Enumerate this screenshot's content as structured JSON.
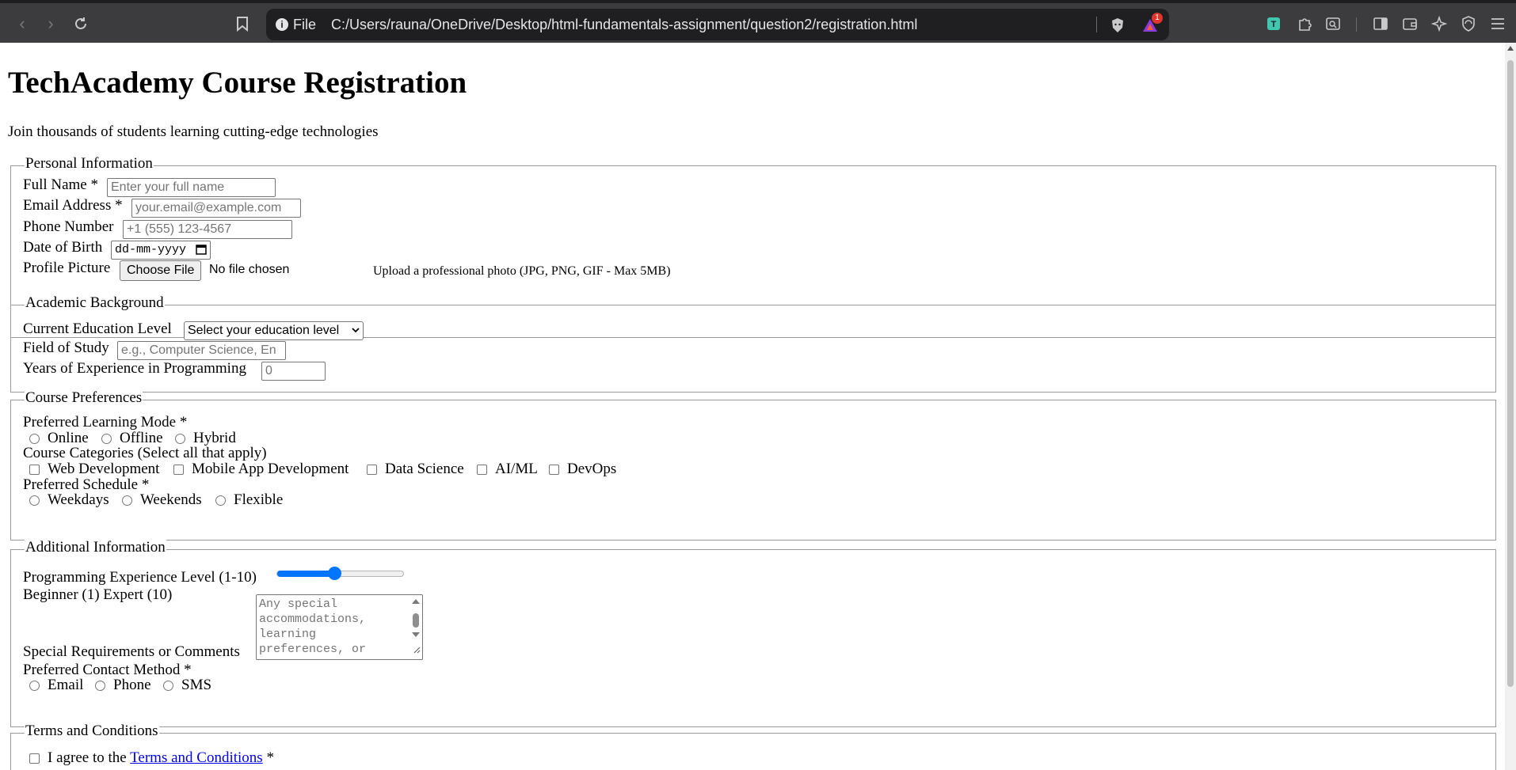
{
  "browser": {
    "file_label": "File",
    "url": "C:/Users/rauna/OneDrive/Desktop/html-fundamentals-assignment/question2/registration.html",
    "notification_count": "1"
  },
  "page": {
    "title": "TechAcademy Course Registration",
    "subtitle": "Join thousands of students learning cutting-edge technologies"
  },
  "personal": {
    "legend": "Personal Information",
    "full_name_label": "Full Name *",
    "full_name_placeholder": "Enter your full name",
    "email_label": "Email Address *",
    "email_placeholder": "your.email@example.com",
    "phone_label": "Phone Number",
    "phone_placeholder": "+1 (555) 123-4567",
    "dob_label": "Date of Birth",
    "dob_value": "dd-mm-yyyy",
    "picture_label": "Profile Picture",
    "choose_file": "Choose File",
    "no_file": "No file chosen",
    "picture_hint": "Upload a professional photo (JPG, PNG, GIF - Max 5MB)"
  },
  "academic": {
    "legend": "Academic Background",
    "education_label": "Current Education Level",
    "education_selected": "Select your education level",
    "field_label": "Field of Study",
    "field_placeholder": "e.g., Computer Science, En",
    "years_label": "Years of Experience in Programming",
    "years_placeholder": "0"
  },
  "course": {
    "legend": "Course Preferences",
    "mode_label": "Preferred Learning Mode *",
    "modes": [
      "Online",
      "Offline",
      "Hybrid"
    ],
    "categories_label": "Course Categories (Select all that apply)",
    "categories": [
      "Web Development",
      "Mobile App Development",
      "Data Science",
      "AI/ML",
      "DevOps"
    ],
    "schedule_label": "Preferred Schedule *",
    "schedules": [
      "Weekdays",
      "Weekends",
      "Flexible"
    ]
  },
  "additional": {
    "legend": "Additional Information",
    "experience_label": "Programming Experience Level (1-10)",
    "experience_value": 5,
    "experience_min": 1,
    "experience_max": 10,
    "scale_hint": "Beginner (1) Expert (10)",
    "comments_label": "Special Requirements or Comments",
    "comments_placeholder": "Any special accommodations, learning preferences, or",
    "contact_label": "Preferred Contact Method *",
    "contacts": [
      "Email",
      "Phone",
      "SMS"
    ]
  },
  "terms": {
    "legend": "Terms and Conditions",
    "agree_prefix": "I agree to the",
    "terms_link": "Terms and Conditions",
    "agree_suffix": "*"
  }
}
